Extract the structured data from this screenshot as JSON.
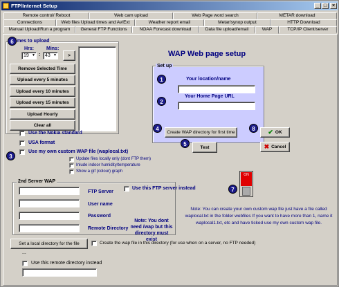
{
  "window": {
    "title": "FTP/Internet Setup",
    "minimize": "_",
    "maximize": "□",
    "close": "×"
  },
  "tabs": {
    "row1": [
      "Remote control/ Reboot",
      "Web cam upload",
      "Web Page word search",
      "METAR download"
    ],
    "row2": [
      "Connections",
      "Web files Upload times and Av/Ext",
      "Weather report email",
      "Metar/synop output",
      "HTTP Download"
    ],
    "row3": [
      "Manual Upload/Run a program",
      "General FTP Functions",
      "NOAA Forecast download",
      "Data file upload/email",
      "WAP",
      "TCP/IP Client/server"
    ],
    "active": "WAP"
  },
  "times": {
    "legend": "Times to upload",
    "hrs_label": "Hrs:",
    "mins_label": "Mins:",
    "hrs_value": "19",
    "mins_value": "43",
    "colon": ":",
    "arrow_label": ">",
    "buttons": [
      "Remove Selected Time",
      "Upload every 5 minutes",
      "Upload every 10 minutes",
      "Upload every 15 minutes",
      "Upload Hourly",
      "Clear all"
    ]
  },
  "options": {
    "nokia": "Use the Nokia standard",
    "usa": "USA format",
    "custom": "Use my own custom WAP file (waplocal.txt)",
    "update_local": "Update files locally only (dont FTP them)",
    "indoor": "Inlude indoor humidity/temperature",
    "gif": "Show a gif (colour) graph"
  },
  "wap": {
    "heading": "WAP Web page setup",
    "setup_legend": "Set up",
    "location_label": "Your location/name",
    "homepage_label": "Your Home Page URL",
    "location_value": "",
    "homepage_value": "",
    "create_btn": "Create WAP directory for first time",
    "test_btn": "Test",
    "ok_btn": "OK",
    "cancel_btn": "Cancel"
  },
  "badges": [
    "1",
    "2",
    "3",
    "4",
    "5",
    "6",
    "7",
    "8"
  ],
  "server2": {
    "legend": "2nd Server WAP",
    "ftp_server": "FTP Server",
    "use_ftp": "Use this FTP server instead",
    "user_name": "User name",
    "password": "Password",
    "remote_dir": "Remote Directory",
    "note": "Note: You dont need /wap but this directory must exist"
  },
  "switch": {
    "state": "ON"
  },
  "note_text": "Note: You can create your own custom wap file just have a file called waplocal.txt in the folder webfiles If you want to have more than 1, name it waplocal1.txt, etc and have ticked use my own custom wap file.",
  "local_dir": {
    "button": "Set a local directory for the file",
    "checkbox": "Create the wap file in this directory (for use when on a server, no FTP needed)",
    "value": "..."
  },
  "remote_instead": {
    "checkbox": "Use this remote directory instead"
  },
  "colors": {
    "titlebar": "#0a246a",
    "group_blue": "#ccccff",
    "badge": "#1a1a8a",
    "switch_red": "#e00000"
  }
}
